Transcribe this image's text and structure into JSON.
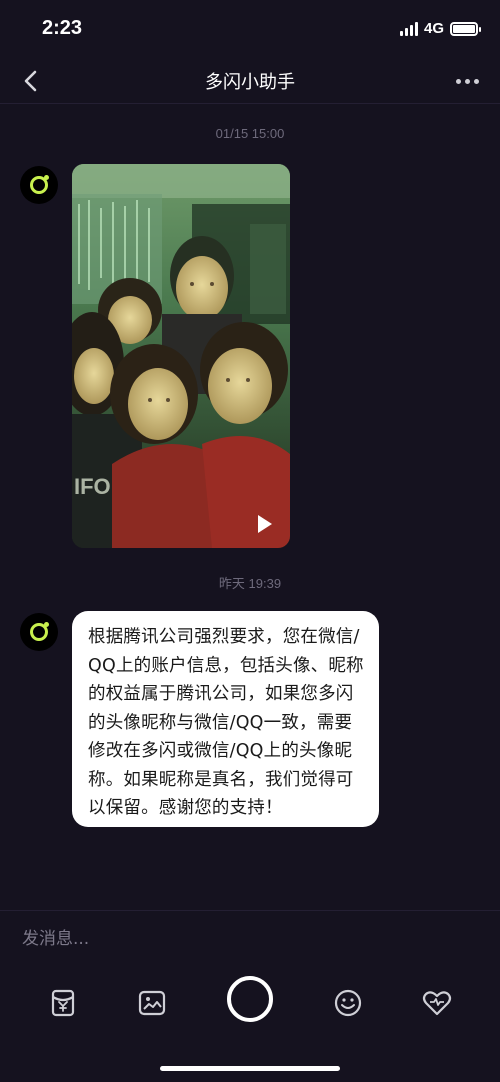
{
  "status_bar": {
    "time": "2:23",
    "network": "4G",
    "battery_level": 1.0
  },
  "nav": {
    "title": "多闪小助手",
    "back_icon": "chevron-left-icon",
    "more_icon": "more-dots-icon"
  },
  "messages": [
    {
      "timestamp": "01/15 15:00",
      "type": "video",
      "sender_avatar": "duoshan-logo-avatar"
    },
    {
      "timestamp": "昨天 19:39",
      "type": "text",
      "sender_avatar": "duoshan-logo-avatar",
      "text": "根据腾讯公司强烈要求，您在微信/QQ上的账户信息，包括头像、昵称的权益属于腾讯公司，如果您多闪的头像昵称与微信/QQ一致，需要修改在多闪或微信/QQ上的头像昵称。如果昵称是真名，我们觉得可以保留。感谢您的支持！"
    }
  ],
  "composer": {
    "placeholder": "发消息...",
    "tools": [
      "red-packet-icon",
      "image-icon",
      "camera-shutter-button",
      "emoji-icon",
      "heart-icon"
    ]
  },
  "colors": {
    "background": "#15121f",
    "bubble": "#ffffff",
    "accent": "#c8f04e",
    "timestamp": "#6e6a7c"
  }
}
